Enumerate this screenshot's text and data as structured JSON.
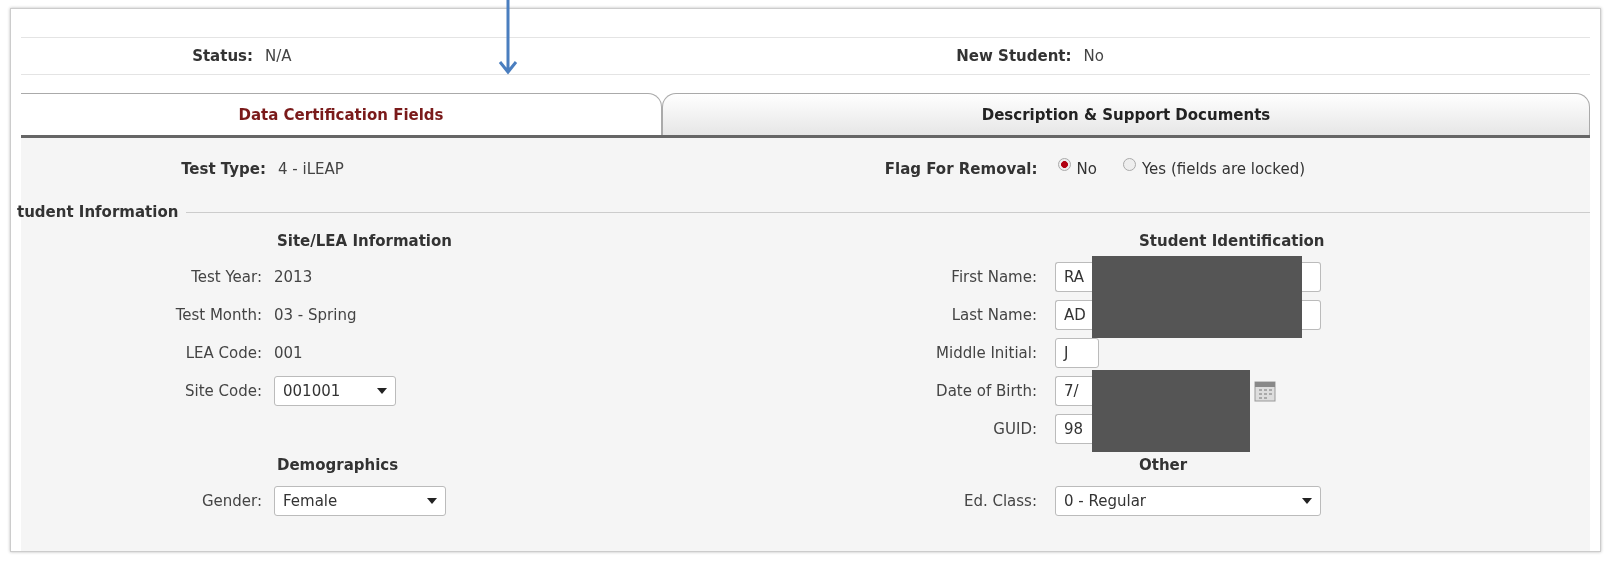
{
  "status_bar": [
    {
      "label": "Status:",
      "value": "N/A"
    },
    {
      "label": "New Student:",
      "value": "No"
    }
  ],
  "tabs": [
    {
      "label": "Data Certification Fields",
      "selected": true
    },
    {
      "label": "Description & Support Documents",
      "selected": false
    }
  ],
  "test_type": {
    "label": "Test Type:",
    "value": "4 - iLEAP"
  },
  "flag_for_removal": {
    "label": "Flag For Removal:",
    "options": [
      {
        "label": "No",
        "selected": true
      },
      {
        "label": "Yes (fields are locked)",
        "selected": false
      }
    ]
  },
  "section": {
    "legend": "tudent Information"
  },
  "columns": [
    {
      "groups": [
        {
          "heading": "Site/LEA Information",
          "fields": [
            {
              "label": "Test Year:",
              "value": "2013",
              "kind": "text"
            },
            {
              "label": "Test Month:",
              "value": "03 - Spring",
              "kind": "text"
            },
            {
              "label": "LEA Code:",
              "value": "001",
              "kind": "text"
            },
            {
              "label": "Site Code:",
              "value": "001001",
              "kind": "select"
            }
          ]
        },
        {
          "heading": "Demographics",
          "fields": [
            {
              "label": "Gender:",
              "value": "Female",
              "kind": "select"
            }
          ]
        }
      ]
    },
    {
      "groups": [
        {
          "heading": "Student Identification",
          "fields": [
            {
              "label": "First Name:",
              "value": "RA",
              "kind": "input",
              "redacted": true
            },
            {
              "label": "Last Name:",
              "value": "AD",
              "kind": "input",
              "redacted": true
            },
            {
              "label": "Middle Initial:",
              "value": "J",
              "kind": "input"
            },
            {
              "label": "Date of Birth:",
              "value": "7/",
              "kind": "date",
              "redacted": true
            },
            {
              "label": "GUID:",
              "value": "98",
              "kind": "input",
              "redacted": true
            }
          ]
        },
        {
          "heading": "Other",
          "fields": [
            {
              "label": "Ed. Class:",
              "value": "0 - Regular",
              "kind": "select"
            }
          ]
        }
      ]
    }
  ]
}
